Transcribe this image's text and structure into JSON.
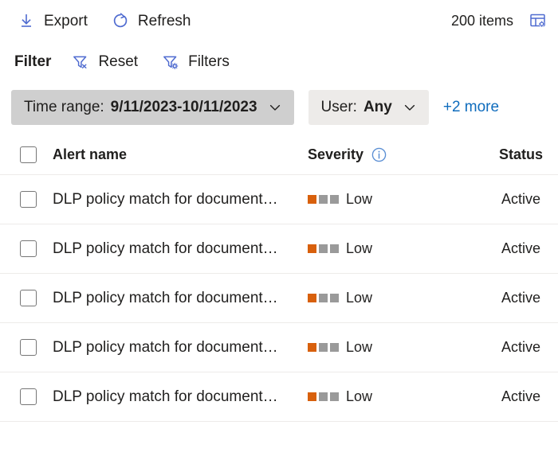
{
  "commandbar": {
    "export": {
      "label": "Export",
      "icon": "download-icon"
    },
    "refresh": {
      "label": "Refresh",
      "icon": "refresh-icon"
    },
    "items_count": "200 items",
    "customize_columns_icon": "customize-columns-icon",
    "overflow_icon": "circle-icon"
  },
  "filterbar": {
    "title": "Filter",
    "reset": {
      "label": "Reset",
      "icon": "filter-clear-icon"
    },
    "filters": {
      "label": "Filters",
      "icon": "filter-settings-icon"
    }
  },
  "pills": [
    {
      "label": "Time range:",
      "value": "9/11/2023-10/11/2023",
      "style": "dark",
      "name": "time-range-filter-pill"
    },
    {
      "label": "User:",
      "value": "Any",
      "style": "light",
      "name": "user-filter-pill"
    }
  ],
  "more_filters_link": "+2 more",
  "table": {
    "columns": {
      "alert_name": "Alert name",
      "severity": "Severity",
      "status": "Status",
      "severity_info_icon": "info-icon"
    },
    "rows": [
      {
        "name": "DLP policy match for document…",
        "severity": "Low",
        "severity_level": 1,
        "status": "Active"
      },
      {
        "name": "DLP policy match for document…",
        "severity": "Low",
        "severity_level": 1,
        "status": "Active"
      },
      {
        "name": "DLP policy match for document…",
        "severity": "Low",
        "severity_level": 1,
        "status": "Active"
      },
      {
        "name": "DLP policy match for document…",
        "severity": "Low",
        "severity_level": 1,
        "status": "Active"
      },
      {
        "name": "DLP policy match for document…",
        "severity": "Low",
        "severity_level": 1,
        "status": "Active"
      }
    ]
  },
  "colors": {
    "accent_blue": "#0f6cbd",
    "severity_low": "#d8600c",
    "severity_empty": "#9a9a9a",
    "pill_dark": "#cfcfcf",
    "pill_light": "#edebe9",
    "divider": "#edebe9"
  }
}
